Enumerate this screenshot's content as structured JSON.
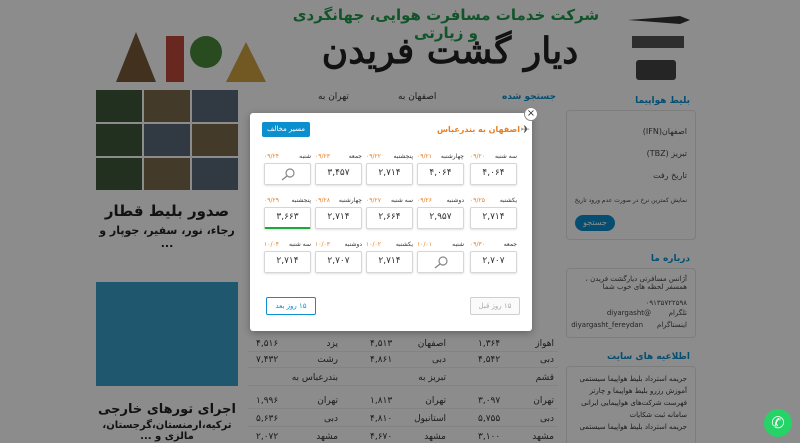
{
  "header": {
    "subtitle": "شرکت خدمات مسافرت هوایی، جهانگردی و زیارتی",
    "title": "دیار گشت فریدن"
  },
  "left": {
    "train_title": "صدور بلیط قطار",
    "train_sub": "رجاء، نور، سفیر، جوپار و ...",
    "tour_title": "اجرای تورهای خارجی",
    "tour_sub": "ترکیه،ارمنستان،گرجستان، مالزی و ..."
  },
  "middle": {
    "search_head": "جستجو شده",
    "col_head_1": "اصفهان به",
    "col_head_2": "تهران به",
    "rows": [
      {
        "a": "تهران",
        "b": "اصفهان",
        "c": "مشهد"
      },
      {
        "a": "مشهد",
        "b": "مشهد",
        "c": "تهران"
      },
      {
        "a": "اهواز",
        "b": "اصفهان",
        "c": "یزد"
      },
      {
        "a": "دبی",
        "b": "دبی",
        "c": "رشت"
      },
      {
        "a": "قشم",
        "b": "تبریز به",
        "c": "بندرعباس به"
      },
      {
        "a": "تهران",
        "b": "تهران",
        "c": "تهران"
      },
      {
        "a": "دبی",
        "b": "استانبول",
        "c": "دبی"
      },
      {
        "a": "مشهد",
        "b": "مشهد",
        "c": "مشهد"
      }
    ],
    "prices": [
      {
        "a": "۱,۳۶۴",
        "b": "۴,۵۱۳",
        "c": "۴,۵۱۶"
      },
      {
        "a": "۴,۵۴۲",
        "b": "۴,۸۶۱",
        "c": "۷,۴۳۲"
      },
      {
        "a": "۳,۰۹۷",
        "b": "۱,۸۱۳",
        "c": "۱,۹۹۶"
      },
      {
        "a": "۵,۷۵۵",
        "b": "۴,۸۱۰",
        "c": "۵,۶۳۶"
      },
      {
        "a": "۳,۱۰۰",
        "b": "۴,۶۷۰",
        "c": "۲,۰۷۲"
      }
    ]
  },
  "right": {
    "flight_ticket_title": "بلیط هواپیما",
    "from_city": "اصفهان(IFN)",
    "to_city": "تبریز (TBZ)",
    "date_label": "تاریخ رفت",
    "price_note": "نمایش کمترین نرخ در صورت عدم ورود تاریخ",
    "search_btn": "جستجو",
    "about_title": "درباره ما",
    "about_text": "آژانس مسافرتی دیارگشت فریدن ، همسفر لحظه های خوب شما",
    "phone": "۰۹۱۳۵۷۲۲۵۹۸",
    "telegram": "@diyargasht",
    "telegram_label": "تلگرام",
    "instagram": "diyargasht_fereydan",
    "instagram_label": "اینستاگرام",
    "info_title": "اطلاعیه های سایت",
    "links": [
      "جریمه استرداد بلیط هواپیما سیستمی",
      "آموزش رزرو بلیط هواپیما و چارتر",
      "فهرست شرکت‌های هواپیمایی ایرانی",
      "سامانه ثبت شکایات",
      "جریمه استرداد بلیط هواپیما سیستمی"
    ]
  },
  "modal": {
    "route": "اصفهان به بندرعباس",
    "return_button": "مسیر مخالف",
    "next_button": "۱۵ روز بعد",
    "prev_button": "۱۵ روز قبل",
    "cells": [
      {
        "day": "سه شنبه",
        "date": "۰۹/۲۰",
        "price": "۴,۰۶۴"
      },
      {
        "day": "چهارشنبه",
        "date": "۰۹/۲۱",
        "price": "۴,۰۶۴"
      },
      {
        "day": "پنجشنبه",
        "date": "۰۹/۲۲",
        "price": "۲,۷۱۴"
      },
      {
        "day": "جمعه",
        "date": "۰۹/۲۳",
        "price": "۳,۴۵۷"
      },
      {
        "day": "شنبه",
        "date": "۰۹/۲۴",
        "price": ""
      },
      {
        "day": "یکشنبه",
        "date": "۰۹/۲۵",
        "price": "۲,۷۱۴"
      },
      {
        "day": "دوشنبه",
        "date": "۰۹/۲۶",
        "price": "۲,۹۵۷"
      },
      {
        "day": "سه شنبه",
        "date": "۰۹/۲۷",
        "price": "۲,۶۶۴"
      },
      {
        "day": "چهارشنبه",
        "date": "۰۹/۲۸",
        "price": "۲,۷۱۴"
      },
      {
        "day": "پنجشنبه",
        "date": "۰۹/۲۹",
        "price": "۳,۶۶۳"
      },
      {
        "day": "جمعه",
        "date": "۰۹/۳۰",
        "price": "۲,۷۰۷"
      },
      {
        "day": "شنبه",
        "date": "۱۰/۰۱",
        "price": ""
      },
      {
        "day": "یکشنبه",
        "date": "۱۰/۰۲",
        "price": "۲,۷۱۴"
      },
      {
        "day": "دوشنبه",
        "date": "۱۰/۰۳",
        "price": "۲,۷۰۷"
      },
      {
        "day": "سه شنبه",
        "date": "۱۰/۰۴",
        "price": "۲,۷۱۴"
      }
    ]
  }
}
